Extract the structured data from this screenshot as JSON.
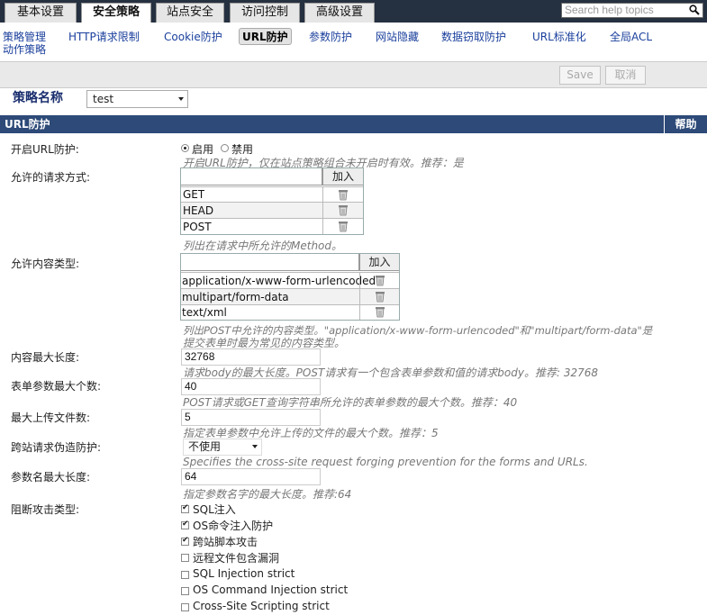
{
  "top_tabs": [
    "基本设置",
    "安全策略",
    "站点安全",
    "访问控制",
    "高级设置"
  ],
  "active_tab": "安全策略",
  "search": {
    "placeholder": "Search help topics"
  },
  "subnav": [
    "策略管理",
    "HTTP请求限制",
    "Cookie防护",
    "URL防护",
    "参数防护",
    "网站隐藏",
    "数据窃取防护",
    "URL标准化",
    "全局ACL"
  ],
  "subnav_second": "动作策略",
  "subnav_active": "URL防护",
  "toolbar": {
    "save": "Save",
    "cancel": "取消"
  },
  "policy": {
    "label": "策略名称",
    "value": "test"
  },
  "section": {
    "title": "URL防护",
    "help": "帮助"
  },
  "url_protect": {
    "label": "开启URL防护:",
    "on": "启用",
    "off": "禁用",
    "selected": "on",
    "hint": "开启URL防护，仅在站点策略组合未开启时有效。推荐：是"
  },
  "methods": {
    "label": "允许的请求方式:",
    "add": "加入",
    "items": [
      "GET",
      "HEAD",
      "POST"
    ],
    "hint": "列出在请求中所允许的Method。"
  },
  "content_types": {
    "label": "允许内容类型:",
    "add": "加入",
    "items": [
      "application/x-www-form-urlencoded",
      "multipart/form-data",
      "text/xml"
    ],
    "hint1": "列出POST中允许的内容类型。\"application/x-www-form-urlencoded\"和\"multipart/form-data\"是",
    "hint2": "提交表单时最为常见的内容类型。"
  },
  "max_content_length": {
    "label": "内容最大长度:",
    "value": "32768",
    "hint": "请求body的最大长度。POST请求有一个包含表单参数和值的请求body。推荐: 32768"
  },
  "max_form_params": {
    "label": "表单参数最大个数:",
    "value": "40",
    "hint": "POST请求或GET查询字符串所允许的表单参数的最大个数。推荐：40"
  },
  "max_upload_files": {
    "label": "最大上传文件数:",
    "value": "5",
    "hint": "指定表单参数中允许上传的文件的最大个数。推荐：5"
  },
  "csrf": {
    "label": "跨站请求伪造防护:",
    "value": "不使用",
    "hint": "Specifies the cross-site request forging prevention for the forms and URLs."
  },
  "max_param_name": {
    "label": "参数名最大长度:",
    "value": "64",
    "hint": "指定参数名字的最大长度。推荐:64"
  },
  "attack_types": {
    "label": "阻断攻击类型:",
    "items": [
      {
        "label": "SQL注入",
        "checked": true
      },
      {
        "label": "OS命令注入防护",
        "checked": true
      },
      {
        "label": "跨站脚本攻击",
        "checked": true
      },
      {
        "label": "远程文件包含漏洞",
        "checked": false
      },
      {
        "label": "SQL Injection strict",
        "checked": false
      },
      {
        "label": "OS Command Injection strict",
        "checked": false
      },
      {
        "label": "Cross-Site Scripting strict",
        "checked": false
      }
    ]
  }
}
